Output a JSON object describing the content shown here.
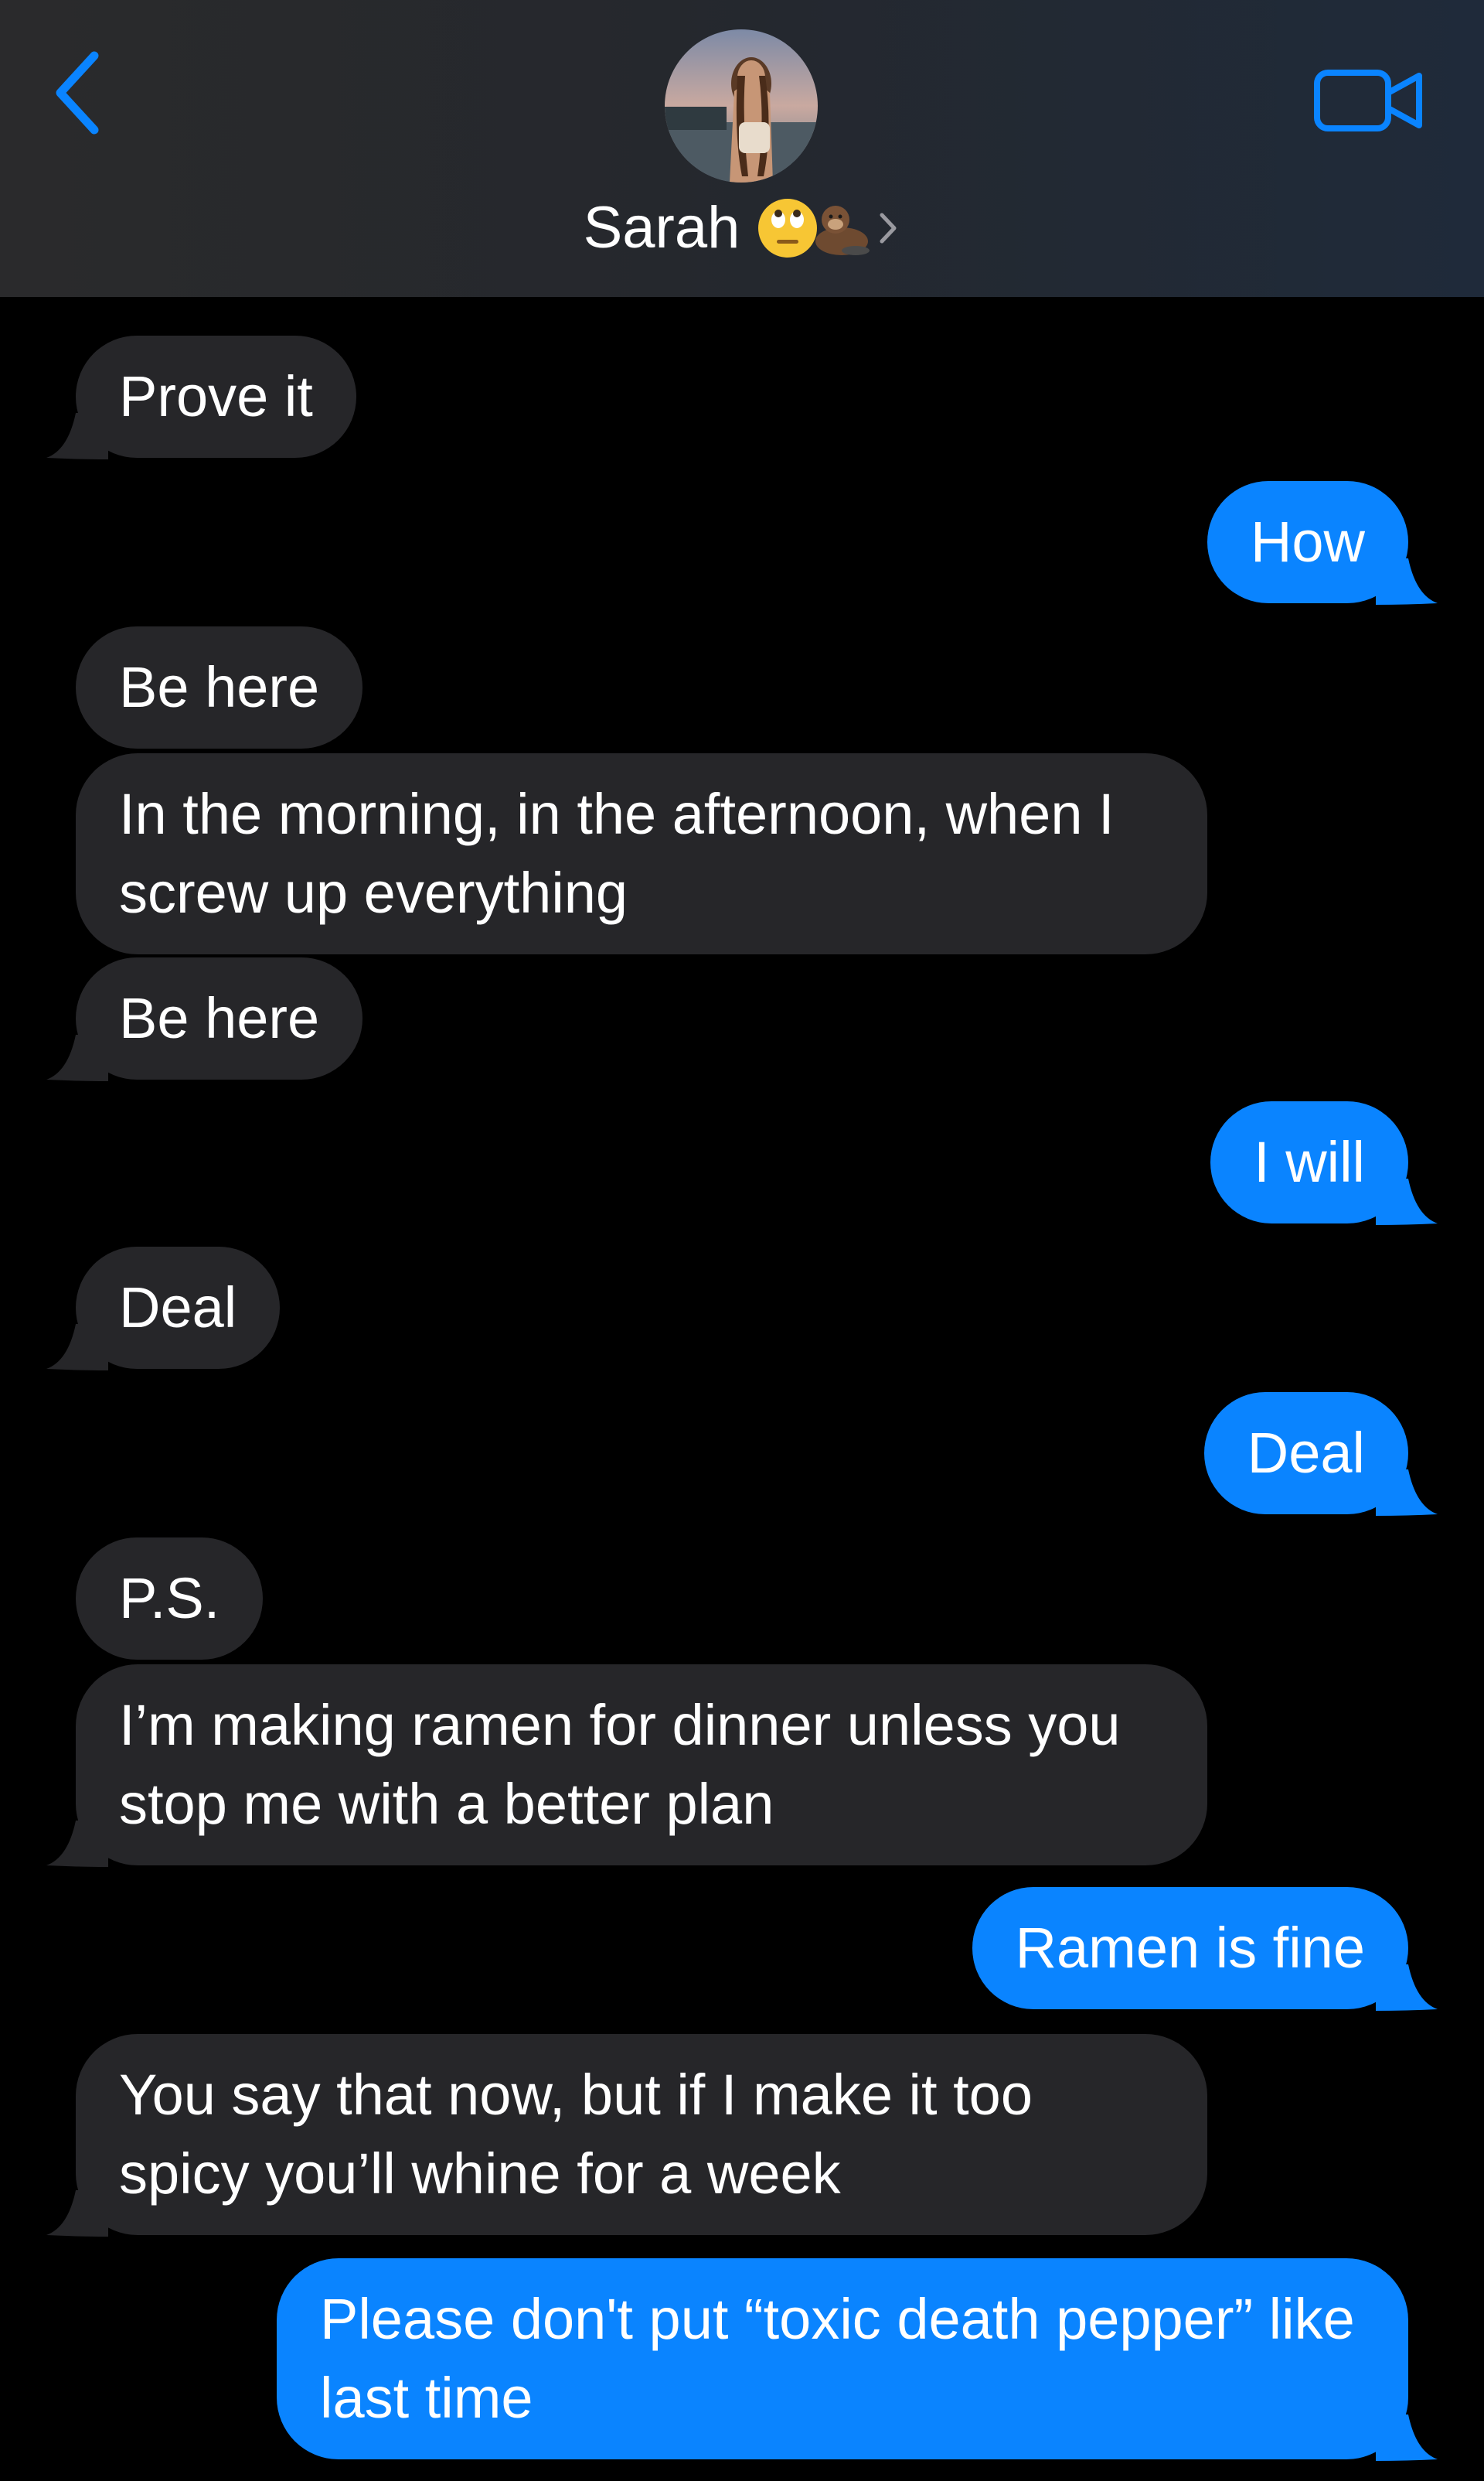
{
  "header": {
    "contact_name": "Sarah",
    "name_emoji": "🙄🦦",
    "back_icon": "chevron-left-icon",
    "video_icon": "video-camera-icon",
    "accent_color": "#0a84ff"
  },
  "messages": [
    {
      "direction": "incoming",
      "text": "Prove it",
      "tail": true
    },
    {
      "direction": "outgoing",
      "text": "How",
      "tail": true
    },
    {
      "direction": "incoming",
      "text": "Be here",
      "tail": false
    },
    {
      "direction": "incoming",
      "text": "In the morning, in the afternoon, when I screw up everything",
      "tail": false
    },
    {
      "direction": "incoming",
      "text": "Be here",
      "tail": true
    },
    {
      "direction": "outgoing",
      "text": "I will",
      "tail": true
    },
    {
      "direction": "incoming",
      "text": "Deal",
      "tail": true
    },
    {
      "direction": "outgoing",
      "text": "Deal",
      "tail": true
    },
    {
      "direction": "incoming",
      "text": "P.S.",
      "tail": false
    },
    {
      "direction": "incoming",
      "text": "I’m making ramen for dinner unless you stop me with a better plan",
      "tail": true
    },
    {
      "direction": "outgoing",
      "text": "Ramen is fine",
      "tail": true
    },
    {
      "direction": "incoming",
      "text": "You say that now, but if I make it too spicy you’ll whine for a week",
      "tail": true
    },
    {
      "direction": "outgoing",
      "text": "Please don't put “toxic death pepper” like last time",
      "tail": true
    }
  ]
}
